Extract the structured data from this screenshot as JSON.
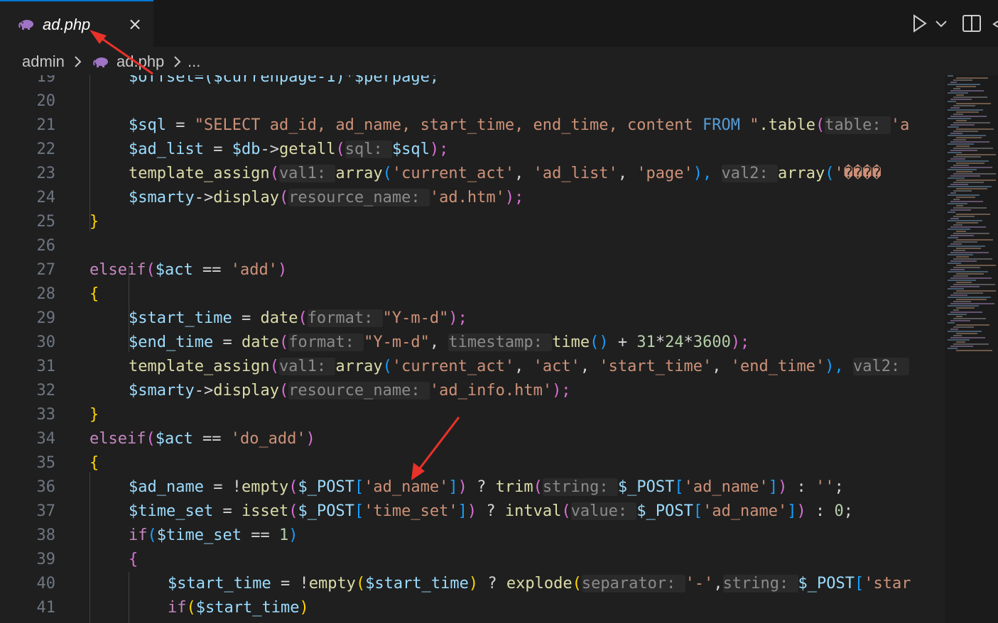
{
  "tab": {
    "label": "ad.php",
    "close_glyph": "×",
    "icon": "php-elephant-icon"
  },
  "breadcrumb": {
    "folder": "admin",
    "file": "ad.php",
    "more": "..."
  },
  "colors": {
    "accent": "#0078d4",
    "arrow": "#e8322a"
  },
  "lines": [
    {
      "n": "19",
      "t": "offset"
    },
    {
      "n": "20",
      "t": "blank"
    },
    {
      "n": "21",
      "t": "sql"
    },
    {
      "n": "22",
      "t": "getall"
    },
    {
      "n": "23",
      "t": "assign1"
    },
    {
      "n": "24",
      "t": "display1"
    },
    {
      "n": "25",
      "t": "close1"
    },
    {
      "n": "26",
      "t": "blank"
    },
    {
      "n": "27",
      "t": "elseif_add"
    },
    {
      "n": "28",
      "t": "open1"
    },
    {
      "n": "29",
      "t": "start"
    },
    {
      "n": "30",
      "t": "end"
    },
    {
      "n": "31",
      "t": "assign2"
    },
    {
      "n": "32",
      "t": "display2"
    },
    {
      "n": "33",
      "t": "close2"
    },
    {
      "n": "34",
      "t": "elseif_doadd"
    },
    {
      "n": "35",
      "t": "open2"
    },
    {
      "n": "36",
      "t": "adname"
    },
    {
      "n": "37",
      "t": "timeset"
    },
    {
      "n": "38",
      "t": "if"
    },
    {
      "n": "39",
      "t": "open3"
    },
    {
      "n": "40",
      "t": "explode"
    },
    {
      "n": "41",
      "t": "if2"
    }
  ],
  "code": {
    "l19": "$offset=($currenpage-1)*$perpage;",
    "l21": [
      "$sql",
      " = ",
      "\"SELECT ad_id, ad_name, start_time, end_time, content ",
      "FROM",
      " \"",
      ".table",
      "(",
      "table: ",
      "'a"
    ],
    "l22": [
      "$ad_list",
      " = ",
      "$db",
      "->",
      "getall",
      "(",
      "sql: ",
      "$sql",
      ");"
    ],
    "l23": [
      "template_assign",
      "(",
      "val1: ",
      "array",
      "(",
      "'current_act'",
      ", ",
      "'ad_list'",
      ", ",
      "'page'",
      "), ",
      "val2: ",
      "array",
      "(",
      "'����"
    ],
    "l24": [
      "$smarty",
      "->",
      "display",
      "(",
      "resource_name: ",
      "'ad.htm'",
      ");"
    ],
    "l27": [
      "elseif",
      "(",
      "$act",
      " == ",
      "'add'",
      ")"
    ],
    "l29": [
      "$start_time",
      " = ",
      "date",
      "(",
      "format: ",
      "\"Y-m-d\"",
      ");"
    ],
    "l30": [
      "$end_time",
      " = ",
      "date",
      "(",
      "format: ",
      "\"Y-m-d\"",
      ", ",
      "timestamp: ",
      "time",
      "()",
      " + ",
      "31",
      "*",
      "24",
      "*",
      "3600",
      ");"
    ],
    "l31": [
      "template_assign",
      "(",
      "val1: ",
      "array",
      "(",
      "'current_act'",
      ", ",
      "'act'",
      ", ",
      "'start_time'",
      ", ",
      "'end_time'",
      "), ",
      "val2: "
    ],
    "l32": [
      "$smarty",
      "->",
      "display",
      "(",
      "resource_name: ",
      "'ad_info.htm'",
      ");"
    ],
    "l34": [
      "elseif",
      "(",
      "$act",
      " == ",
      "'do_add'",
      ")"
    ],
    "l36": [
      "$ad_name",
      " = ",
      "!",
      "empty",
      "(",
      "$_POST",
      "[",
      "'ad_name'",
      "]",
      ")",
      " ? ",
      "trim",
      "(",
      "string: ",
      "$_POST",
      "[",
      "'ad_name'",
      "]",
      ")",
      " : ",
      "''",
      ";"
    ],
    "l37": [
      "$time_set",
      " = ",
      "isset",
      "(",
      "$_POST",
      "[",
      "'time_set'",
      "]",
      ")",
      " ? ",
      "intval",
      "(",
      "value: ",
      "$_POST",
      "[",
      "'ad_name'",
      "]",
      ")",
      " : ",
      "0",
      ";"
    ],
    "l38": [
      "if",
      "(",
      "$time_set",
      " == ",
      "1",
      ")"
    ],
    "l40": [
      "$start_time",
      " = ",
      "!",
      "empty",
      "(",
      "$start_time",
      ")",
      " ? ",
      "explode",
      "(",
      "separator: ",
      "'-'",
      ",",
      "string: ",
      "$_POST",
      "[",
      "'star"
    ],
    "l41": [
      "if",
      "(",
      "$start_time",
      ")"
    ],
    "brace_open": "{",
    "brace_close": "}"
  }
}
